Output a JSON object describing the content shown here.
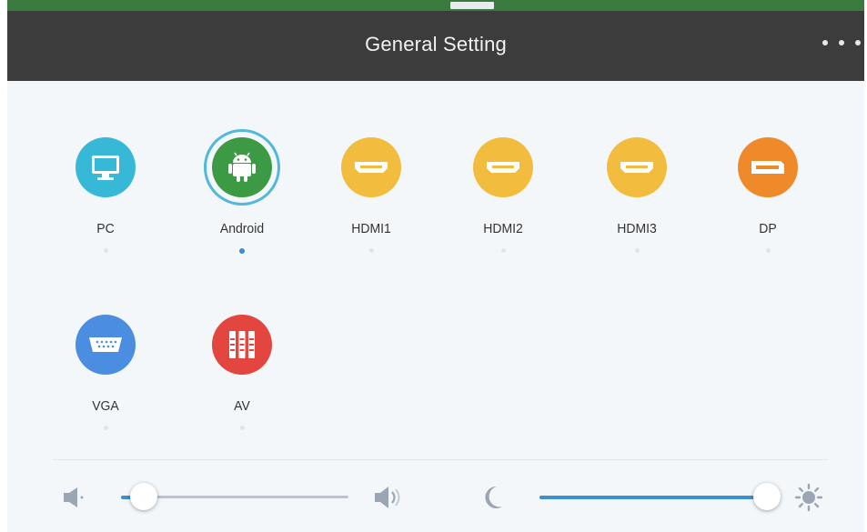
{
  "header": {
    "title": "General Setting"
  },
  "sources": [
    {
      "label": "PC",
      "icon": "monitor-icon",
      "color": "#37b8d6",
      "selected": false
    },
    {
      "label": "Android",
      "icon": "android-icon",
      "color": "#3c9a44",
      "selected": true
    },
    {
      "label": "HDMI1",
      "icon": "hdmi-port-icon",
      "color": "#f2bd3e",
      "selected": false
    },
    {
      "label": "HDMI2",
      "icon": "hdmi-port-icon",
      "color": "#f2bd3e",
      "selected": false
    },
    {
      "label": "HDMI3",
      "icon": "hdmi-port-icon",
      "color": "#f2bd3e",
      "selected": false
    },
    {
      "label": "DP",
      "icon": "displayport-icon",
      "color": "#ef8a2a",
      "selected": false
    },
    {
      "label": "VGA",
      "icon": "vga-port-icon",
      "color": "#4b8de0",
      "selected": false
    },
    {
      "label": "AV",
      "icon": "av-rca-icon",
      "color": "#e2463f",
      "selected": false
    }
  ],
  "controls": {
    "volume": {
      "level": 0.1,
      "min_icon": "volume-low-icon",
      "max_icon": "volume-high-icon"
    },
    "brightness": {
      "level": 1.0,
      "min_icon": "moon-icon",
      "max_icon": "sun-icon"
    }
  },
  "colors": {
    "header_bg": "#3c3c3c",
    "accent": "#3e8fd0",
    "panel_bg": "#f4f7fa"
  }
}
